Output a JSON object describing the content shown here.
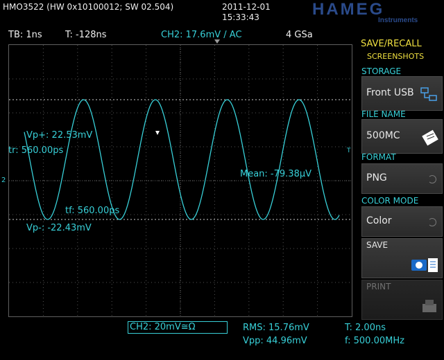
{
  "header": {
    "model": "HMO3522 (HW 0x10100012; SW 02.504)",
    "date": "2011-12-01",
    "time": "15:33:43",
    "brand": "HAMEG",
    "brand_sub": "Instruments"
  },
  "status": {
    "timebase": "TB: 1ns",
    "trigger_time": "T: -128ns",
    "channel": "CH2: 17.6mV / AC",
    "sample_rate": "4 GSa"
  },
  "measurements": {
    "vp_plus": "Vp+: 22.53mV",
    "rise": "tr: 560.00ps",
    "fall": "tf: 560.00ps",
    "vp_minus": "Vp-: -22.43mV",
    "mean": "Mean: -79.38µV",
    "trigger_marker": "T",
    "ch_marker": "2"
  },
  "waveform": {
    "color": "#38d0d8",
    "frequency_mhz": 500,
    "amplitude_mv": 22.5
  },
  "footer": {
    "channel_setting": "CH2: 20mV≅Ω",
    "rms": "RMS: 15.76mV",
    "vpp": "Vpp: 44.96mV",
    "period": "T: 2.00ns",
    "freq": "f: 500.00MHz"
  },
  "menu": {
    "title": "SAVE/RECALL",
    "subtitle": "SCREENSHOTS",
    "storage_title": "STORAGE",
    "storage_value": "Front USB",
    "filename_title": "FILE NAME",
    "filename_value": "500MC",
    "format_title": "FORMAT",
    "format_value": "PNG",
    "color_title": "COLOR MODE",
    "color_value": "Color",
    "save_label": "SAVE",
    "print_label": "PRINT"
  }
}
